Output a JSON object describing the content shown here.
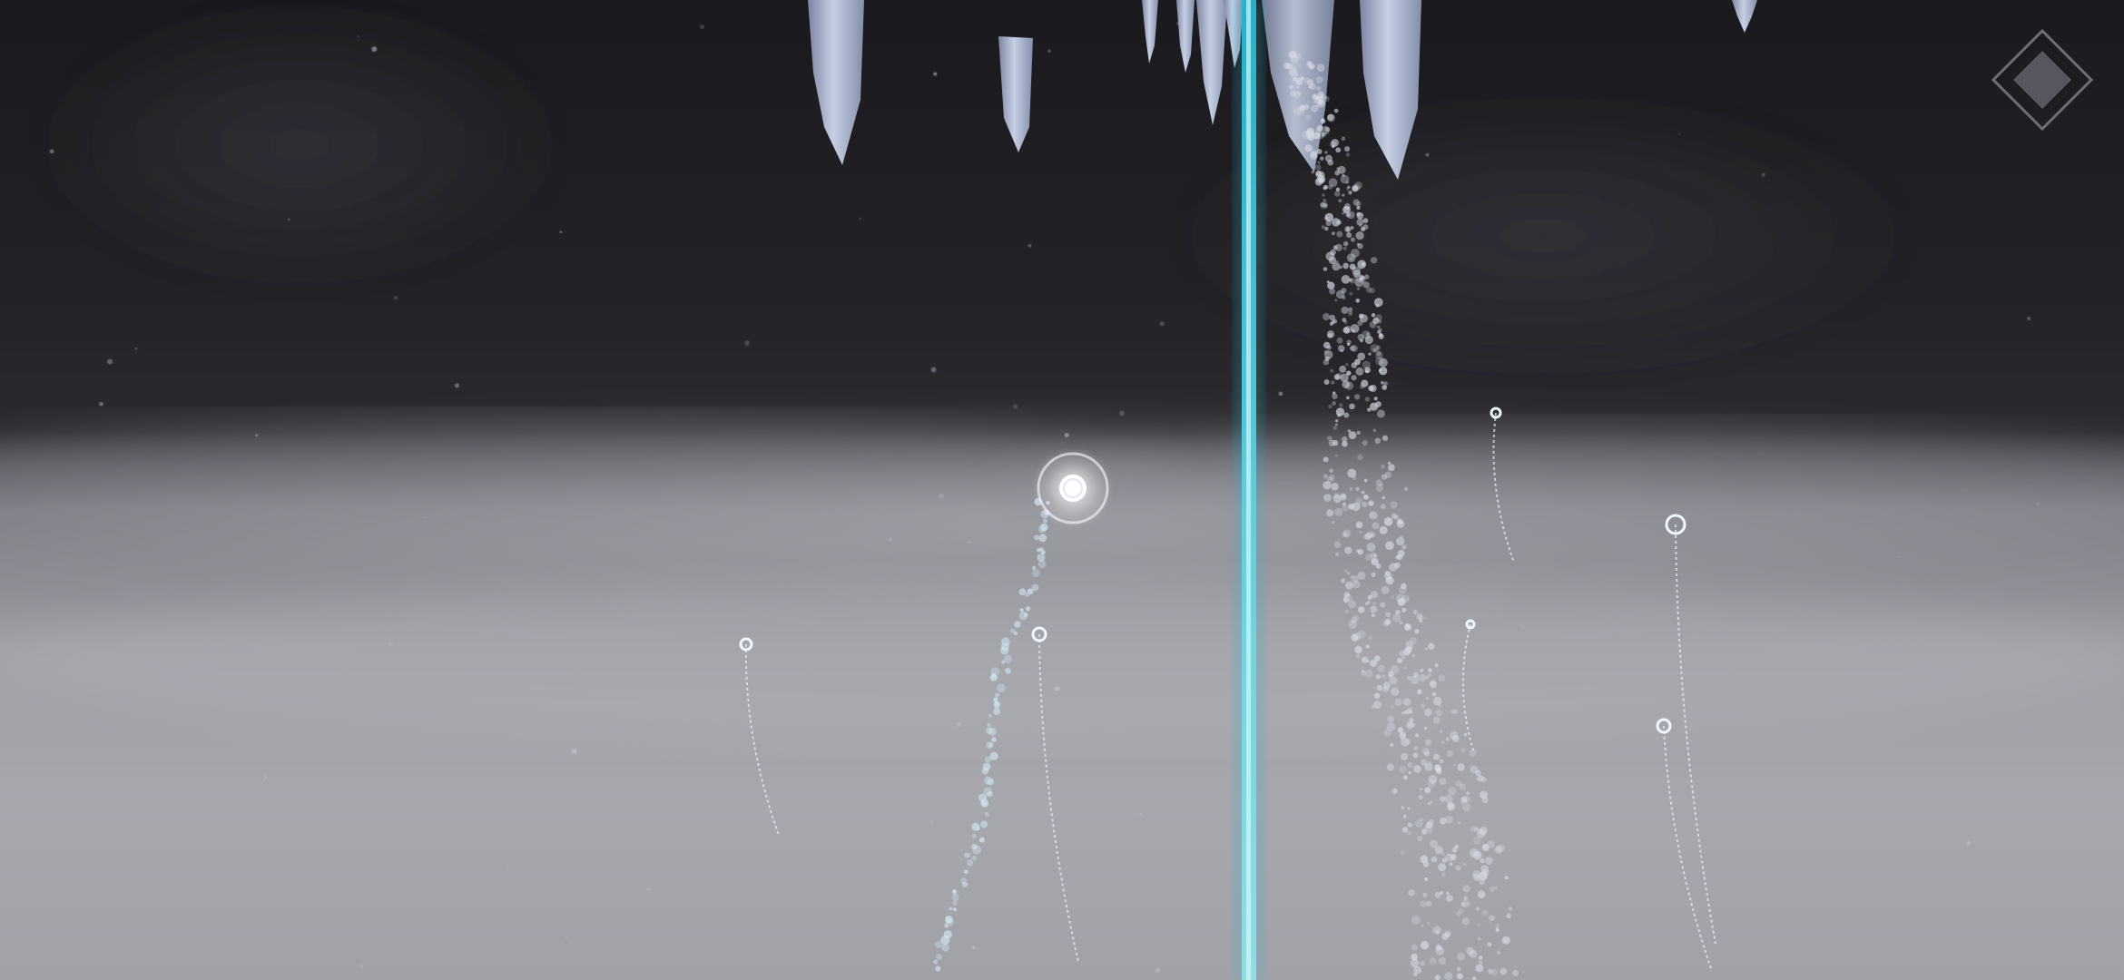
{
  "game": {
    "scene": "icy-cavern-fog",
    "icons": {
      "pause": "diamond-pause-icon"
    },
    "colors": {
      "sky_top": "#1a1a1e",
      "fog": "#a3a3aa",
      "ice": "#a9b3c9",
      "laser": "#38c9dc",
      "orb": "#ffffff",
      "sprout": "#e8f2ff",
      "mist_column": "#d6dae4"
    }
  }
}
